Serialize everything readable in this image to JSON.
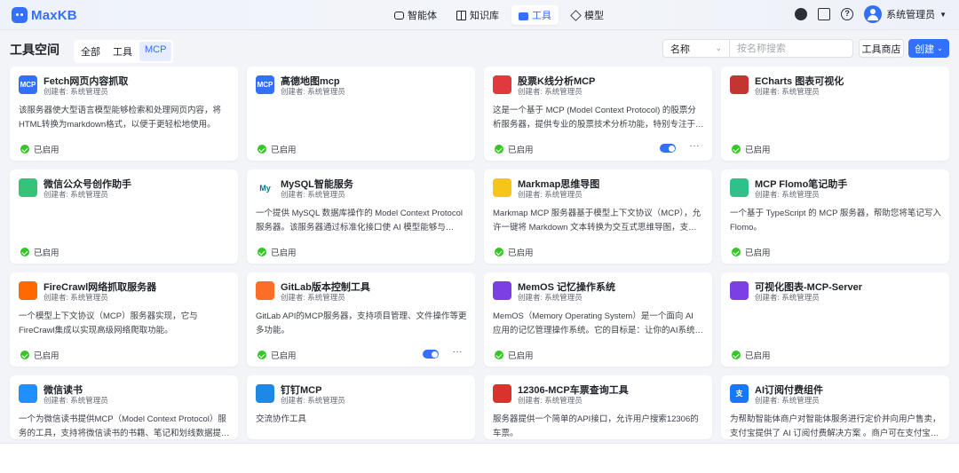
{
  "app": {
    "brand": "MaxKB"
  },
  "nav": {
    "items": [
      {
        "label": "智能体",
        "icon": "agent-icon"
      },
      {
        "label": "知识库",
        "icon": "book-icon"
      },
      {
        "label": "工具",
        "icon": "tool-icon",
        "active": true
      },
      {
        "label": "模型",
        "icon": "cube-icon"
      }
    ]
  },
  "user": {
    "name": "系统管理员"
  },
  "page": {
    "title": "工具空间",
    "tabs": [
      {
        "label": "全部"
      },
      {
        "label": "工具"
      },
      {
        "label": "MCP",
        "active": true
      }
    ],
    "filter": {
      "field": "名称",
      "placeholder": "按名称搜索"
    },
    "store_label": "工具商店",
    "create_label": "创建"
  },
  "status_label": "已启用",
  "cards": [
    {
      "name": "Fetch网页内容抓取",
      "creator": "创建者: 系统管理员",
      "desc": "该服务器使大型语言模型能够检索和处理网页内容，将HTML转换为markdown格式，以便于更轻松地使用。",
      "icon": "mcp-icon",
      "icon_text": "MCP",
      "color": "#3370ff",
      "toggle": false
    },
    {
      "name": "高德地图mcp",
      "creator": "创建者: 系统管理员",
      "desc": "",
      "icon": "mcp-icon",
      "icon_text": "MCP",
      "color": "#3370ff",
      "toggle": false
    },
    {
      "name": "股票K线分析MCP",
      "creator": "创建者: 系统管理员",
      "desc": "这是一个基于 MCP (Model Context Protocol) 的股票分析服务器，提供专业的股票技术分析功能，特别专注于K线形态分析。",
      "icon": "stock-chart-icon",
      "icon_text": "",
      "color": "#e03a3e",
      "toggle": true
    },
    {
      "name": "ECharts 图表可视化",
      "creator": "创建者: 系统管理员",
      "desc": "",
      "icon": "echarts-icon",
      "icon_text": "",
      "color": "#c23531",
      "toggle": false
    },
    {
      "name": "微信公众号创作助手",
      "creator": "创建者: 系统管理员",
      "desc": "",
      "icon": "wechat-writer-icon",
      "icon_text": "",
      "color": "#35c37a",
      "toggle": false
    },
    {
      "name": "MySQL智能服务",
      "creator": "创建者: 系统管理员",
      "desc": "一个提供 MySQL 数据库操作的 Model Context Protocol 服务器。该服务器通过标准化接口使 AI 模型能够与 MySQL 数据库进行交互。",
      "icon": "mysql-icon",
      "icon_text": "My",
      "color": "#ffffff",
      "toggle": false
    },
    {
      "name": "Markmap思维导图",
      "creator": "创建者: 系统管理员",
      "desc": "Markmap MCP 服务器基于模型上下文协议（MCP），允许一键将 Markdown 文本转换为交互式思维导图，支持多种导出格式。",
      "icon": "markmap-icon",
      "icon_text": "",
      "color": "#f5c518",
      "toggle": false
    },
    {
      "name": "MCP Flomo笔记助手",
      "creator": "创建者: 系统管理员",
      "desc": "一个基于 TypeScript 的 MCP 服务器，帮助您将笔记写入 Flomo。",
      "icon": "flomo-icon",
      "icon_text": "",
      "color": "#30c18b",
      "toggle": false
    },
    {
      "name": "FireCrawl网络抓取服务器",
      "creator": "创建者: 系统管理员",
      "desc": "一个模型上下文协议（MCP）服务器实现，它与FireCrawl集成以实现高级网络爬取功能。",
      "icon": "fire-icon",
      "icon_text": "",
      "color": "#ff6a00",
      "toggle": false
    },
    {
      "name": "GitLab版本控制工具",
      "creator": "创建者: 系统管理员",
      "desc": "GitLab API的MCP服务器，支持项目管理、文件操作等更多功能。",
      "icon": "gitlab-icon",
      "icon_text": "",
      "color": "#fc6d26",
      "toggle": true
    },
    {
      "name": "MemOS 记忆操作系统",
      "creator": "创建者: 系统管理员",
      "desc": "MemOS（Memory Operating System）是一个面向 AI 应用的记忆管理操作系统。它的目标是：让你的AI系统像人一样拥有长期记忆。",
      "icon": "memos-icon",
      "icon_text": "",
      "color": "#7b3fe4",
      "toggle": false
    },
    {
      "name": "可视化图表-MCP-Server",
      "creator": "创建者: 系统管理员",
      "desc": "",
      "icon": "chart-server-icon",
      "icon_text": "",
      "color": "#7b3fe4",
      "toggle": false
    },
    {
      "name": "微信读书",
      "creator": "创建者: 系统管理员",
      "desc": "一个为微信读书提供MCP（Model Context Protocol）服务的工具，支持将微信读书的书籍、笔记和划线数据提供给支持MCP的大语言模型客户端。",
      "icon": "weread-icon",
      "icon_text": "",
      "color": "#1e90ff",
      "toggle": false
    },
    {
      "name": "钉钉MCP",
      "creator": "创建者: 系统管理员",
      "desc": "交流协作工具",
      "icon": "dingtalk-icon",
      "icon_text": "",
      "color": "#1e88e5",
      "toggle": false
    },
    {
      "name": "12306-MCP车票查询工具",
      "creator": "创建者: 系统管理员",
      "desc": "服务器提供一个简单的API接口，允许用户搜索12306的车票。",
      "icon": "railway-icon",
      "icon_text": "",
      "color": "#d9342b",
      "toggle": false
    },
    {
      "name": "AI订阅付费组件",
      "creator": "创建者: 系统管理员",
      "desc": "为帮助智能体商户对智能体服务进行定价并向用户售卖，支付宝提供了 AI 订阅付费解决方案 。商户可在支付宝端内创建智能体的付费订阅。",
      "icon": "alipay-icon",
      "icon_text": "支",
      "color": "#1677ff",
      "toggle": false
    }
  ]
}
